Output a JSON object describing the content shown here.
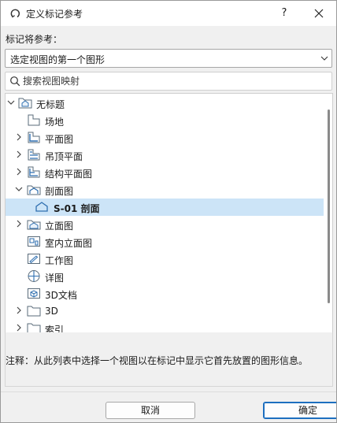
{
  "window": {
    "title": "定义标记参考",
    "help_label": "?",
    "icons": {
      "app": "refresh-arrow-icon",
      "close": "close-icon"
    }
  },
  "reference": {
    "label": "标记将参考：",
    "selected_value": "选定视图的第一个图形"
  },
  "search": {
    "placeholder": "搜索视图映射"
  },
  "tree": {
    "items": [
      {
        "label": "无标题",
        "icon": "project-folder-icon",
        "expander": "expanded"
      },
      {
        "label": "场地",
        "icon": "site-view-icon",
        "expander": "none"
      },
      {
        "label": "平面图",
        "icon": "floor-plan-icon",
        "expander": "collapsed"
      },
      {
        "label": "吊顶平面",
        "icon": "ceiling-plan-icon",
        "expander": "collapsed"
      },
      {
        "label": "结构平面图",
        "icon": "structural-plan-icon",
        "expander": "collapsed"
      },
      {
        "label": "剖面图",
        "icon": "section-icon",
        "expander": "expanded"
      },
      {
        "label": "S-01 剖面",
        "icon": "section-view-icon",
        "expander": "none",
        "selected": true
      },
      {
        "label": "立面图",
        "icon": "elevation-icon",
        "expander": "collapsed"
      },
      {
        "label": "室内立面图",
        "icon": "interior-elevation-icon",
        "expander": "none"
      },
      {
        "label": "工作图",
        "icon": "worksheet-icon",
        "expander": "none"
      },
      {
        "label": "详图",
        "icon": "detail-icon",
        "expander": "none"
      },
      {
        "label": "3D文档",
        "icon": "3d-document-icon",
        "expander": "none"
      },
      {
        "label": "3D",
        "icon": "folder-icon",
        "expander": "collapsed"
      },
      {
        "label": "索引",
        "icon": "folder-icon",
        "expander": "collapsed"
      }
    ]
  },
  "note": {
    "text": "注释：从此列表中选择一个视图以在标记中显示它首先放置的图形信息。"
  },
  "buttons": {
    "cancel": "取消",
    "ok": "确定"
  },
  "colors": {
    "selected_row": "#cce4f7",
    "accent": "#1d6fbf"
  }
}
